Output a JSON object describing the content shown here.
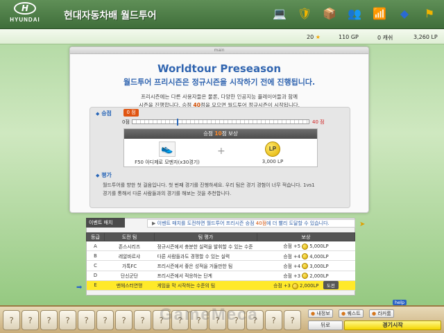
{
  "header": {
    "logo_mark": "H",
    "logo_word": "HYUNDAI",
    "title": "현대자동차배 월드투어",
    "icons": [
      {
        "name": "laptop-icon",
        "glyph": "💻",
        "color": "#2a6ad1"
      },
      {
        "name": "shield-icon",
        "glyph": "🛡",
        "color": "#f2b400"
      },
      {
        "name": "box-icon",
        "glyph": "📦",
        "color": "#2a6ad1"
      },
      {
        "name": "people-icon",
        "glyph": "👥",
        "color": "#f2b400"
      },
      {
        "name": "wifi-icon",
        "glyph": "📶",
        "color": "#2a6ad1"
      },
      {
        "name": "cube-icon",
        "glyph": "◆",
        "color": "#2a6ad1"
      },
      {
        "name": "flag-icon",
        "glyph": "⚑",
        "color": "#f2b400"
      }
    ]
  },
  "status": {
    "stars": "20",
    "gp": "110 GP",
    "cash": "0 캐쉬",
    "lp": "3,260 LP"
  },
  "window": {
    "tab_label": "main",
    "title": "Worldtour  Preseason",
    "subtitle": "월드투어 프리시즌은 정규시즌을 시작하기 전에 진행됩니다.",
    "intro_line1": "프리시즌에는 다른 사용자들은 물론, 다양한 인공지능 플레이어들과 함께",
    "intro_line2_a": "시즌을 진행합니다. 승점",
    "intro_line2_hl": "40",
    "intro_line2_b": "점을 모으면 월드투어 정규시즌이 시작됩니다."
  },
  "progress": {
    "label": "승점",
    "current_badge": "0 점",
    "min_label": "0점",
    "max_label": "40 점",
    "current": 0,
    "max": 40,
    "marker_at": 10
  },
  "reward": {
    "head_a": "승점",
    "head_hl": "10",
    "head_b": "점 보상",
    "item1_label": "F50 아디제로 모멘자(x30경기)",
    "item2_coin": "LP",
    "item2_label": "3,000 LP",
    "plus": "+"
  },
  "evaluation": {
    "label": "평가",
    "line1": "월드투어를 향한 첫 걸음입니다. 첫 번째 경기를 진행하세요. 우리 팀은 경기 경험이 너무 적습니다. 1vs1",
    "line2": "경기를 통해서 다른 사람들과의 경기를 해보는 것을 추천합니다."
  },
  "events": {
    "tab_label": "이벤트 매치",
    "notice_a": "이벤트 매치를 도전하면 월드투어 프리시즌 승점",
    "notice_hl": "40점",
    "notice_b": "에 더 빨리 도달할 수 있습니다.",
    "columns": [
      "등급",
      "도전 팀",
      "팀 평가",
      "보상"
    ],
    "rows": [
      {
        "grade": "A",
        "team": "존스시리즈",
        "eval": "정규시즌에서 충분한 실력을 발휘할 수 있는 수준",
        "pts": "승점 +5",
        "lp": "5,000LP",
        "btn": ""
      },
      {
        "grade": "B",
        "team": "레알바르샤",
        "eval": "다른 사람들과도 경쟁할 수 있는 실력",
        "pts": "승점 +4",
        "lp": "4,000LP",
        "btn": ""
      },
      {
        "grade": "C",
        "team": "가톡FC",
        "eval": "프리시즌에서 좋은 성적을 거둘만한 팀",
        "pts": "승점 +4",
        "lp": "3,000LP",
        "btn": ""
      },
      {
        "grade": "D",
        "team": "단신군단",
        "eval": "프리시즌에서 적응하는 단계",
        "pts": "승점 +3",
        "lp": "2,000LP",
        "btn": ""
      },
      {
        "grade": "E",
        "team": "맨헤스터연맹",
        "eval": "게임을 막 시작하는 수준의 팀",
        "pts": "승점 +3",
        "lp": "2,000LP",
        "btn": "도전"
      }
    ]
  },
  "bottom": {
    "slots": [
      "?",
      "?",
      "?",
      "?",
      "?",
      "?",
      "?",
      "?",
      "?",
      "?",
      "?",
      "?",
      "?",
      "?",
      "?",
      "?"
    ],
    "nav": [
      "내정보",
      "퀘스트",
      "라커룸"
    ],
    "back": "뒤로",
    "start": "경기시작",
    "help": "help",
    "watermark": "GameMeca"
  },
  "colors": {
    "accent_blue": "#3165b0",
    "accent_orange": "#e05512",
    "selected_row": "#ffe92a"
  }
}
